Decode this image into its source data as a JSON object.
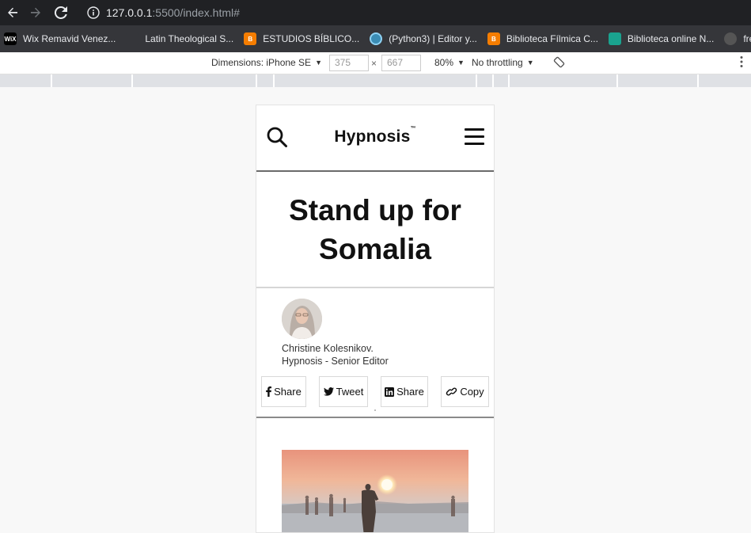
{
  "browser": {
    "url_host": "127.0.0.1",
    "url_rest": ":5500/index.html#",
    "bookmarks": [
      {
        "label": "Wix Remavid Venez...",
        "icon": "wix-icon",
        "color": "#000000",
        "icon_text": "WiX"
      },
      {
        "label": "Latin Theological S...",
        "icon": "bookmark-icon",
        "color": "#35363a",
        "icon_text": ""
      },
      {
        "label": "ESTUDIOS BÍBLICO...",
        "icon": "blogger-icon",
        "color": "#f57d00",
        "icon_text": "B"
      },
      {
        "label": "(Python3) | Editor y...",
        "icon": "python-editor-icon",
        "color": "#3b8db5",
        "icon_text": ""
      },
      {
        "label": "Biblioteca Fílmica C...",
        "icon": "blogger-icon",
        "color": "#f57d00",
        "icon_text": "B"
      },
      {
        "label": "Biblioteca online N...",
        "icon": "stack-icon",
        "color": "#1aa38f",
        "icon_text": ""
      },
      {
        "label": "free",
        "icon": "github-icon",
        "color": "#35363a",
        "icon_text": ""
      }
    ]
  },
  "devtools": {
    "dimensions_label": "Dimensions: iPhone SE",
    "width": "375",
    "height": "667",
    "times": "×",
    "zoom": "80%",
    "throttling": "No throttling"
  },
  "site": {
    "brand": "Hypnosis",
    "brand_mark": "™",
    "headline": "Stand up for Somalia",
    "author_name": "Christine Kolesnikov.",
    "author_role": "Hypnosis - Senior Editor",
    "share_buttons": [
      {
        "label": "Share",
        "icon": "facebook-icon"
      },
      {
        "label": "Tweet",
        "icon": "twitter-icon"
      },
      {
        "label": "Share",
        "icon": "linkedin-icon"
      },
      {
        "label": "Copy",
        "icon": "link-icon"
      }
    ]
  }
}
